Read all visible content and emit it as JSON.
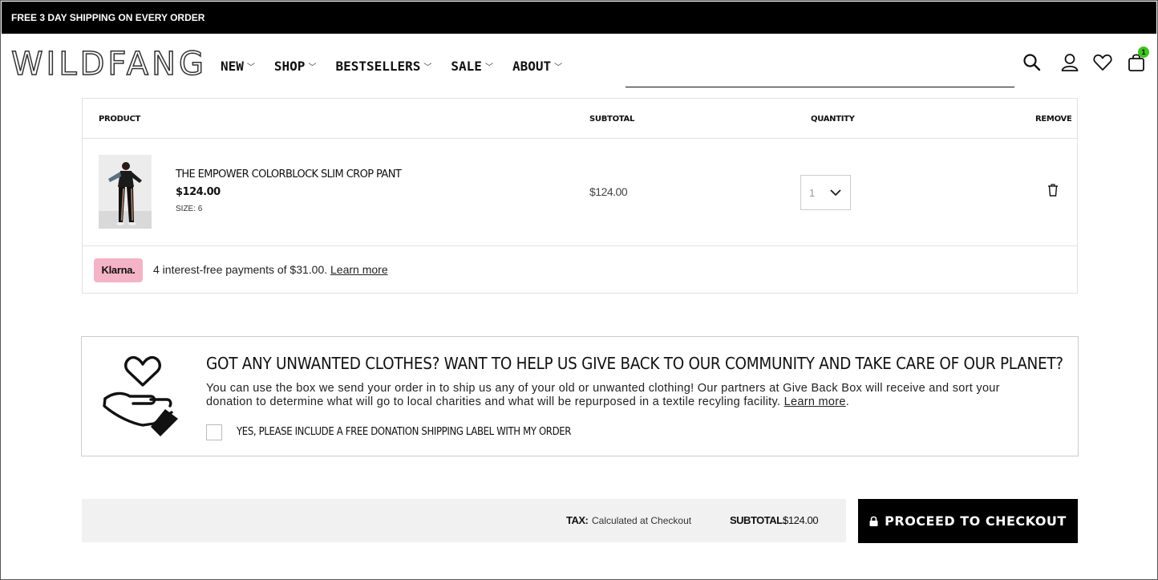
{
  "promo": {
    "text": "FREE 3 DAY SHIPPING ON EVERY ORDER"
  },
  "header": {
    "logo": "WILDFANG",
    "nav": [
      {
        "label": "NEW"
      },
      {
        "label": "SHOP"
      },
      {
        "label": "BESTSELLERS"
      },
      {
        "label": "SALE"
      },
      {
        "label": "ABOUT"
      }
    ],
    "search": {
      "value": "",
      "placeholder": ""
    },
    "icons": [
      "search-icon",
      "account-icon",
      "wishlist-heart-icon",
      "cart-bag-icon"
    ],
    "cart_count": "1",
    "badge_color": "#3ec41f"
  },
  "cart": {
    "columns": {
      "product": "PRODUCT",
      "subtotal": "SUBTOTAL",
      "quantity": "QUANTITY",
      "remove": "REMOVE"
    },
    "items": [
      {
        "name": "THE EMPOWER COLORBLOCK SLIM CROP PANT",
        "price": "$124.00",
        "size": "SIZE: 6",
        "subtotal": "$124.00",
        "quantity": "1"
      }
    ],
    "klarna": {
      "badge": "Klarna.",
      "text": "4 interest-free payments of $31.00.",
      "link": "Learn more",
      "badge_color": "#f5b3c8"
    }
  },
  "donation": {
    "title": "GOT ANY UNWANTED CLOTHES? WANT TO HELP US GIVE BACK TO OUR COMMUNITY AND TAKE CARE OF OUR PLANET?",
    "body": "You can use the box we send your order in to ship us any of your old or unwanted clothing! Our partners at Give Back Box will receive and sort your donation to determine what will go to local charities and what will be repurposed in a textile recyling facility.",
    "link": "Learn more",
    "checkbox_label": "YES, PLEASE INCLUDE A FREE DONATION SHIPPING LABEL WITH MY ORDER",
    "checked": false
  },
  "summary": {
    "tax_label": "TAX:",
    "tax_value": "Calculated at Checkout",
    "subtotal_label": "SUBTOTAL:",
    "subtotal_value": "$124.00",
    "checkout_label": "PROCEED TO CHECKOUT"
  }
}
